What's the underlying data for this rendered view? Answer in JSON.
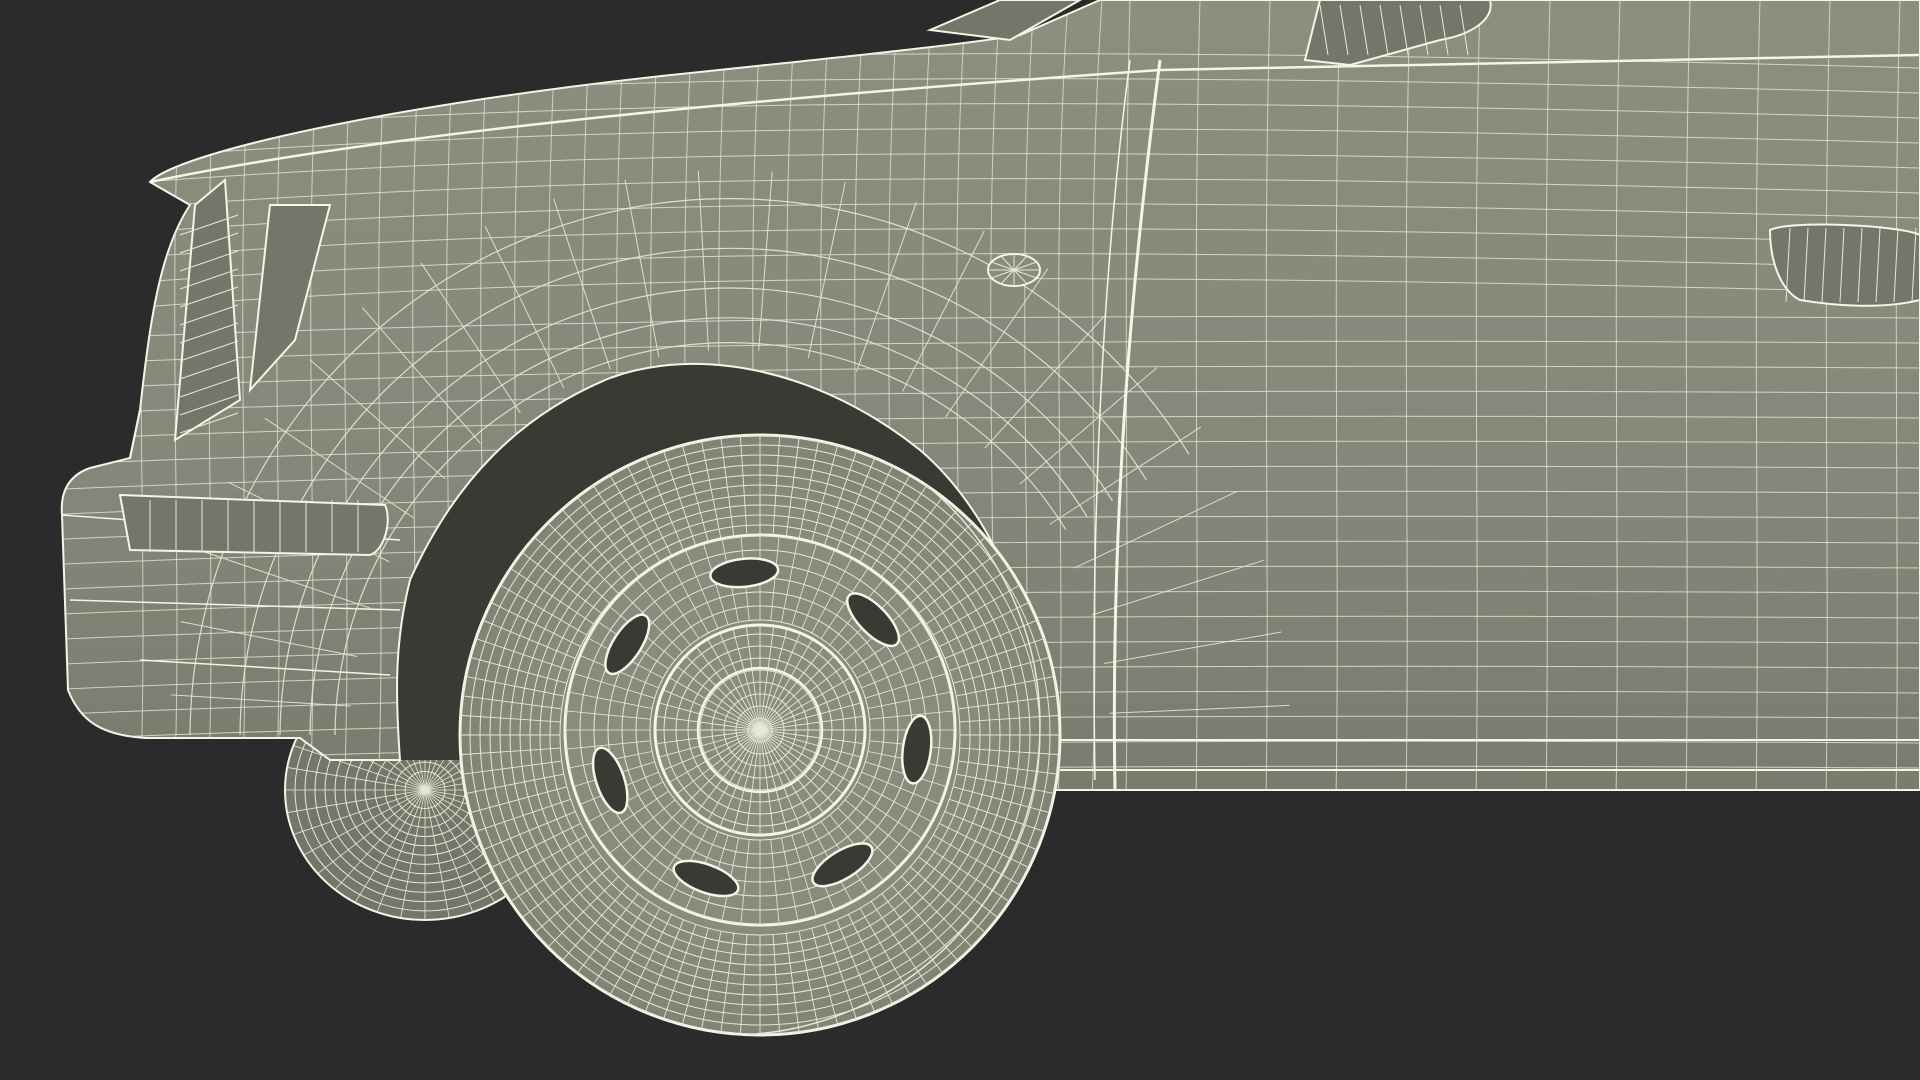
{
  "scene": {
    "background_color": "#2b2b2b",
    "body_fill": "#8a8b7c",
    "body_shade": "#75766a",
    "wire_color": "#e6e8d6",
    "wire_bright": "#f4f5e6",
    "dark_gap": "#3a3a34",
    "subject": "car-front-wireframe"
  }
}
